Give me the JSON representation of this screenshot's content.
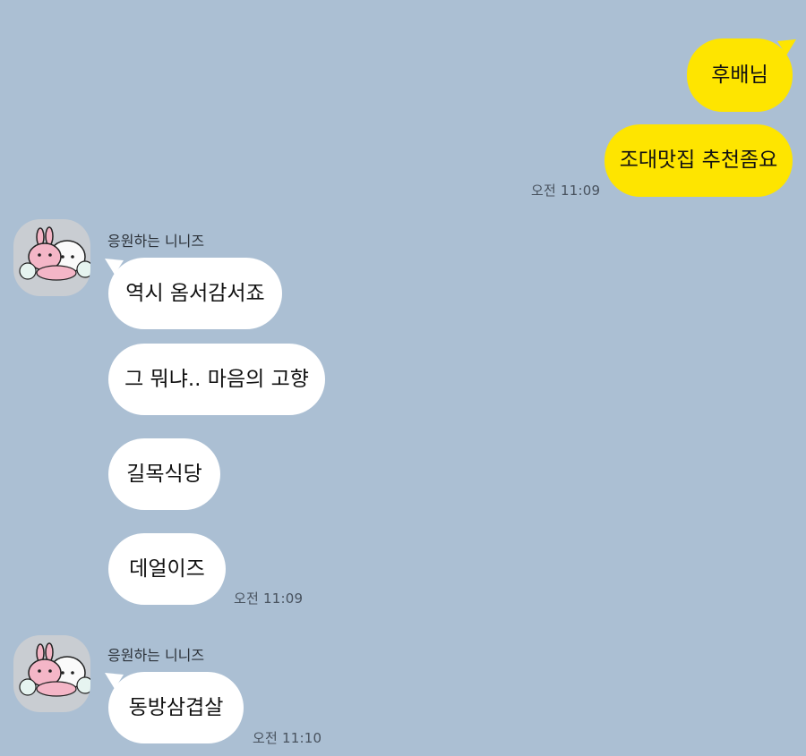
{
  "chat": {
    "sent": {
      "messages": [
        "후배님",
        "조대맛집 추천좀요"
      ],
      "time": "오전 11:09"
    },
    "group1": {
      "sender": "응원하는 니니즈",
      "messages": [
        "역시 옴서감서죠",
        "그 뭐냐.. 마음의 고향",
        "길목식당",
        "데얼이즈"
      ],
      "time": "오전 11:09"
    },
    "group2": {
      "sender": "응원하는 니니즈",
      "messages": [
        "동방삼겹살"
      ],
      "time": "오전 11:10"
    },
    "colors": {
      "background": "#abbfd3",
      "my_bubble": "#fee500",
      "their_bubble": "#ffffff"
    },
    "avatar_icon": "niniz-rabbit-avatar-icon"
  }
}
